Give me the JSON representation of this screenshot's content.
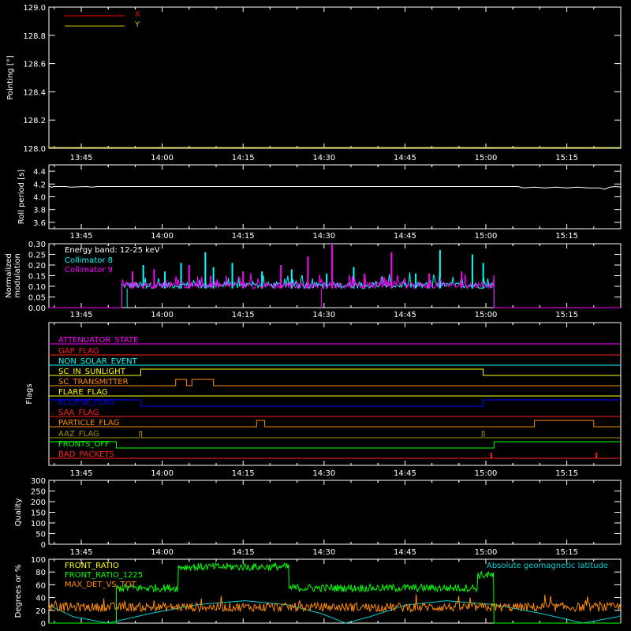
{
  "colors": {
    "background": "#000000",
    "axes": "#ffffff",
    "x_trace": "#ff0000",
    "y_trace": "#c8c800",
    "col8": "#00ffff",
    "col9": "#ff00ff",
    "front_ratio": "#ffff00",
    "front_ratio_1225": "#00ff00",
    "max_det": "#ff8c00",
    "geo_lat": "#00d0d0"
  },
  "time_axis": {
    "start_min": 819,
    "end_min": 925,
    "tick_min": [
      825,
      840,
      855,
      870,
      885,
      900,
      915
    ],
    "tick_labels": [
      "13:45",
      "14:00",
      "14:15",
      "14:30",
      "14:45",
      "15:00",
      "15:15"
    ]
  },
  "chart_data": [
    {
      "id": "pointing",
      "type": "line",
      "ylabel": "Pointing [°]",
      "ylim": [
        128.0,
        129.0
      ],
      "yticks": [
        128.0,
        128.2,
        128.4,
        128.6,
        128.8,
        129.0
      ],
      "ytick_labels": [
        "128.0",
        "128.2",
        "128.4",
        "128.6",
        "128.8",
        "129.0"
      ],
      "legend_placement": "top-left",
      "series": [
        {
          "name": "X",
          "color_key": "x_trace",
          "x": [
            819,
            925
          ],
          "y": [
            128.0,
            128.0
          ]
        },
        {
          "name": "Y",
          "color_key": "y_trace",
          "x": [
            819,
            925
          ],
          "y": [
            128.0,
            128.0
          ]
        }
      ]
    },
    {
      "id": "roll",
      "type": "line",
      "ylabel": "Roll period [s]",
      "ylim": [
        3.5,
        4.5
      ],
      "yticks": [
        3.6,
        3.8,
        4.0,
        4.2,
        4.4
      ],
      "ytick_labels": [
        "3.6",
        "3.8",
        "4.0",
        "4.2",
        "4.4"
      ],
      "series": [
        {
          "name": "",
          "color_key": "axes",
          "x": [
            819,
            819.5,
            820,
            822,
            823,
            826,
            827,
            828,
            829,
            831,
            834,
            835,
            845,
            850,
            860,
            880,
            900,
            906,
            907,
            909,
            911,
            913,
            915,
            917,
            919,
            921,
            922,
            923,
            924,
            925
          ],
          "y": [
            4.17,
            4.15,
            4.16,
            4.16,
            4.15,
            4.16,
            4.15,
            4.16,
            4.16,
            4.16,
            4.16,
            4.16,
            4.16,
            4.16,
            4.16,
            4.16,
            4.16,
            4.16,
            4.14,
            4.15,
            4.14,
            4.15,
            4.14,
            4.15,
            4.14,
            4.14,
            4.12,
            4.15,
            4.16,
            4.15
          ]
        }
      ]
    },
    {
      "id": "modulation",
      "type": "line",
      "ylabel": "Normalized modulation",
      "ylim": [
        0.0,
        0.3
      ],
      "yticks": [
        0.0,
        0.05,
        0.1,
        0.15,
        0.2,
        0.25,
        0.3
      ],
      "ytick_labels": [
        "0.00",
        "0.05",
        "0.10",
        "0.15",
        "0.20",
        "0.25",
        "0.30"
      ],
      "annotation": "Energy band: 12-25 keV",
      "legend_placement": "top-left",
      "active_range": [
        832.5,
        901.5
      ],
      "baseline": 0.09,
      "series": [
        {
          "name": "Collimator 8",
          "color_key": "col8",
          "spikes_x": [
            836.5,
            840.5,
            843.5,
            848.0,
            849.5,
            853.0,
            858.5,
            864.0,
            870.5,
            875.5,
            887.0,
            891.5,
            897.5,
            899.5
          ],
          "spikes_y": [
            0.2,
            0.17,
            0.21,
            0.26,
            0.19,
            0.21,
            0.17,
            0.18,
            0.16,
            0.19,
            0.16,
            0.27,
            0.25,
            0.21
          ]
        },
        {
          "name": "Collimator 9",
          "color_key": "col9",
          "spikes_x": [
            834.5,
            838.5,
            845.0,
            849.0,
            855.0,
            862.0,
            867.0,
            871.5,
            877.5,
            882.5,
            889.5,
            895.5
          ],
          "spikes_y": [
            0.17,
            0.18,
            0.2,
            0.15,
            0.17,
            0.2,
            0.24,
            0.3,
            0.16,
            0.26,
            0.16,
            0.17
          ]
        }
      ]
    },
    {
      "id": "flags",
      "type": "line",
      "ylabel": "Flags",
      "series": [
        {
          "name": "ATTENUATOR_STATE",
          "color": "#ff00ff",
          "x": [
            819,
            925
          ],
          "y": [
            0,
            0
          ]
        },
        {
          "name": "GAP_FLAG",
          "color": "#ff2020",
          "x": [
            819,
            925
          ],
          "y": [
            0,
            0
          ]
        },
        {
          "name": "NON_SOLAR_EVENT",
          "color": "#00ffff",
          "x": [
            819,
            925
          ],
          "y": [
            0,
            0
          ]
        },
        {
          "name": "SC_IN_SUNLIGHT",
          "color": "#ffff00",
          "x": [
            819,
            836,
            836,
            899.5,
            899.5,
            925
          ],
          "y": [
            0,
            0,
            1,
            1,
            0,
            0
          ]
        },
        {
          "name": "SC_TRANSMITTER",
          "color": "#ff8c00",
          "x": [
            819,
            842.5,
            842.5,
            844.5,
            844.5,
            845.5,
            845.5,
            849.5,
            849.5,
            925
          ],
          "y": [
            0,
            0,
            1,
            1,
            0,
            0,
            1,
            1,
            0,
            0
          ]
        },
        {
          "name": "FLARE_FLAG",
          "color": "#ffff00",
          "x": [
            819,
            925
          ],
          "y": [
            0,
            0
          ]
        },
        {
          "name": "ECLIPSE_FLAG",
          "color": "#0000ff",
          "x": [
            819,
            836,
            836,
            899.5,
            899.5,
            925
          ],
          "y": [
            1,
            1,
            0,
            0,
            1,
            1
          ]
        },
        {
          "name": "SAA_FLAG",
          "color": "#ff2020",
          "x": [
            819,
            925
          ],
          "y": [
            0,
            0
          ]
        },
        {
          "name": "PARTICLE_FLAG",
          "color": "#ff8c00",
          "x": [
            819,
            857.5,
            857.5,
            859,
            859,
            909,
            909,
            920,
            920,
            925
          ],
          "y": [
            0,
            0,
            1,
            1,
            0,
            0,
            1,
            1,
            0,
            0
          ]
        },
        {
          "name": "AAZ_FLAG",
          "color": "#a09000",
          "x": [
            819,
            835.8,
            835.8,
            836.2,
            836.2,
            899.3,
            899.3,
            899.7,
            899.7,
            925
          ],
          "y": [
            0,
            0,
            1,
            1,
            0,
            0,
            1,
            1,
            0,
            0
          ]
        },
        {
          "name": "FRONTS_OFF",
          "color": "#00ff00",
          "x": [
            819,
            831.5,
            831.5,
            901.5,
            901.5,
            925
          ],
          "y": [
            1,
            1,
            0,
            0,
            1,
            1
          ]
        },
        {
          "name": "BAD_PACKETS",
          "color": "#ff2020",
          "x": [
            819,
            925
          ],
          "y": [
            0,
            0
          ],
          "ticks_x": [
            901.0,
            920.5
          ]
        }
      ]
    },
    {
      "id": "quality",
      "type": "line",
      "ylabel": "Quality",
      "ylim": [
        0,
        300
      ],
      "yticks": [
        0,
        50,
        100,
        150,
        200,
        250,
        300
      ],
      "ytick_labels": [
        "0",
        "50",
        "100",
        "150",
        "200",
        "250",
        "300"
      ],
      "series": [
        {
          "name": "",
          "color_key": "axes",
          "x": [
            819,
            925
          ],
          "y": [
            0,
            0
          ]
        }
      ]
    },
    {
      "id": "ratios",
      "type": "line",
      "ylabel": "Degrees or %",
      "ylim": [
        0,
        100
      ],
      "yticks": [
        0,
        20,
        40,
        60,
        80,
        100
      ],
      "ytick_labels": [
        "0",
        "20",
        "40",
        "60",
        "80",
        "100"
      ],
      "legend_placement": "top-left",
      "series": [
        {
          "name": "FRONT_RATIO",
          "color_key": "front_ratio"
        },
        {
          "name": "FRONT_RATIO_1225",
          "color_key": "front_ratio_1225",
          "segments_x": [
            831.5,
            843.0,
            863.5,
            872.0,
            898.5,
            901.5
          ],
          "segments_y": [
            55,
            88,
            55,
            55,
            75
          ]
        },
        {
          "name": "MAX_DET_VS_TOT",
          "color_key": "max_det",
          "mean": 25
        },
        {
          "name": "Absolute geomagnetic latitude",
          "color_key": "geo_lat",
          "x": [
            819,
            823.5,
            830.0,
            837.7,
            846.5,
            855.3,
            863.0,
            869.5,
            874.0,
            878.5,
            885.0,
            892.7,
            901.5,
            910.3,
            918.0,
            924.5,
            925
          ],
          "y": [
            28,
            10,
            0,
            15,
            29,
            35,
            29,
            15,
            0,
            10,
            28,
            35,
            29,
            15,
            0,
            10,
            12
          ]
        }
      ]
    }
  ]
}
